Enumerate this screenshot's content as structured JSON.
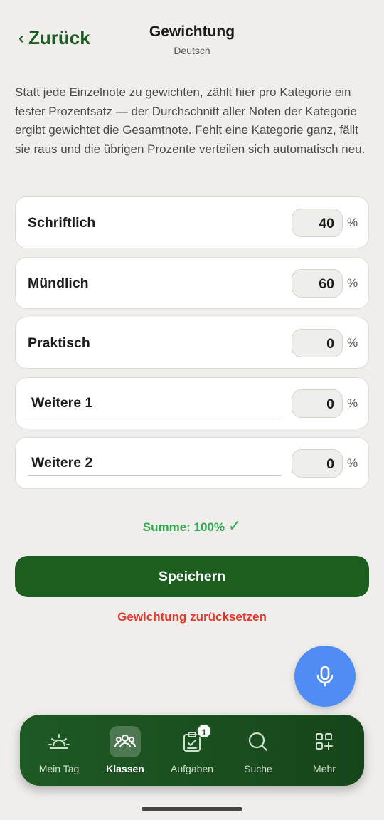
{
  "header": {
    "back_label": "Zurück",
    "title": "Gewichtung",
    "subtitle": "Deutsch"
  },
  "description": "Statt jede Einzelnote zu gewichten, zählt hier pro Kategorie ein fester Prozentsatz — der Durchschnitt aller Noten der Kategorie ergibt gewichtet die Gesamtnote. Fehlt eine Kategorie ganz, fällt sie raus und die übrigen Prozente verteilen sich automatisch neu.",
  "categories": [
    {
      "label": "Schriftlich",
      "value": "40",
      "unit": "%"
    },
    {
      "label": "Mündlich",
      "value": "60",
      "unit": "%"
    },
    {
      "label": "Praktisch",
      "value": "0",
      "unit": "%"
    },
    {
      "label": "Weitere 1",
      "value": "0",
      "unit": "%"
    },
    {
      "label": "Weitere 2",
      "value": "0",
      "unit": "%"
    }
  ],
  "sum": {
    "text": "Summe: 100%",
    "check": "✓"
  },
  "save_label": "Speichern",
  "reset_label": "Gewichtung zurücksetzen",
  "tabs": [
    {
      "label": "Mein Tag",
      "icon": "sunrise-icon"
    },
    {
      "label": "Klassen",
      "icon": "people-icon"
    },
    {
      "label": "Aufgaben",
      "icon": "clipboard-check-icon",
      "badge": "1"
    },
    {
      "label": "Suche",
      "icon": "search-icon"
    },
    {
      "label": "Mehr",
      "icon": "grid-plus-icon"
    }
  ],
  "colors": {
    "primary": "#1b5e20",
    "success": "#2eaa52",
    "danger": "#de3b2c",
    "fab": "#4f8df5"
  }
}
